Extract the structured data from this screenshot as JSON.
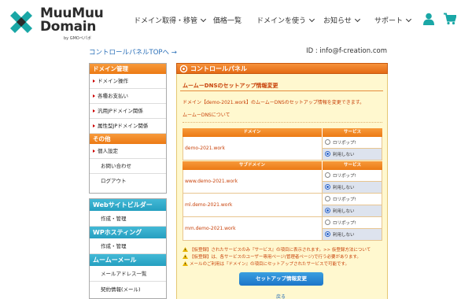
{
  "header": {
    "logo_line1": "MuuMuu",
    "logo_line2": "Domain",
    "logo_by": "by GMOペパボ",
    "nav": [
      {
        "label": "ドメイン取得・移管"
      },
      {
        "label": "価格一覧"
      },
      {
        "label": "ドメインを使う"
      },
      {
        "label": "お知らせ"
      },
      {
        "label": "サポート"
      }
    ],
    "icons": [
      "user-icon",
      "cart-icon"
    ],
    "accent_color": "#1aa7a6"
  },
  "top": {
    "control_panel_link": "コントロールパネルTOPへ →",
    "user_id": "ID : info@f-creation.com"
  },
  "sidebar": {
    "domain_section": "ドメイン管理",
    "domain_items": [
      "ドメイン操作",
      "各種お支払い",
      "汎用JPドメイン関係",
      "属性型JPドメイン関係"
    ],
    "other_section": "その他",
    "other_items": [
      "個人設定",
      "お問い合わせ",
      "ログアウト"
    ],
    "sections2": [
      {
        "title": "Webサイトビルダー",
        "items": [
          "作成・管理"
        ]
      },
      {
        "title": "WPホスティング",
        "items": [
          "作成・管理"
        ]
      },
      {
        "title": "ムームーメール",
        "items": [
          "メールアドレス一覧",
          "契約情報(メール)"
        ]
      }
    ]
  },
  "panel": {
    "title": "コントロールパネル",
    "subtitle": "ムームーDNSのセットアップ情報変更",
    "description": "ドメイン【demo-2021.work】のムームーDNSのセットアップ情報を変更できます。",
    "about_link": "ムームーDNSについて",
    "domain_header": "ドメイン",
    "service_header": "サービス",
    "subdomain_header": "サブドメイン",
    "domain_rows": [
      {
        "name": "demo-2021.work",
        "option1": "ロリポップ!",
        "option2": "利用しない",
        "selected": 2
      }
    ],
    "subdomain_rows": [
      {
        "name": "www.demo-2021.work",
        "option1": "ロリポップ!",
        "option2": "利用しない",
        "selected": 2
      },
      {
        "name": "ml.demo-2021.work",
        "option1": "ロリポップ!",
        "option2": "利用しない",
        "selected": 2
      },
      {
        "name": "mm.demo-2021.work",
        "option1": "ロリポップ!",
        "option2": "利用しない",
        "selected": 2
      }
    ],
    "notes": [
      "【仮登録】されたサービスのみ『サービス』の項目に表示されます。>> 仮登録方法について",
      "【仮登録】は、各サービスのユーザー専用ページ(管理者ページ)で行う必要があります。",
      "メールのご利用は『ドメイン』の項目にセットアップされたサービスで可能です。"
    ],
    "submit_label": "セットアップ情報変更",
    "back_label": "戻る"
  }
}
